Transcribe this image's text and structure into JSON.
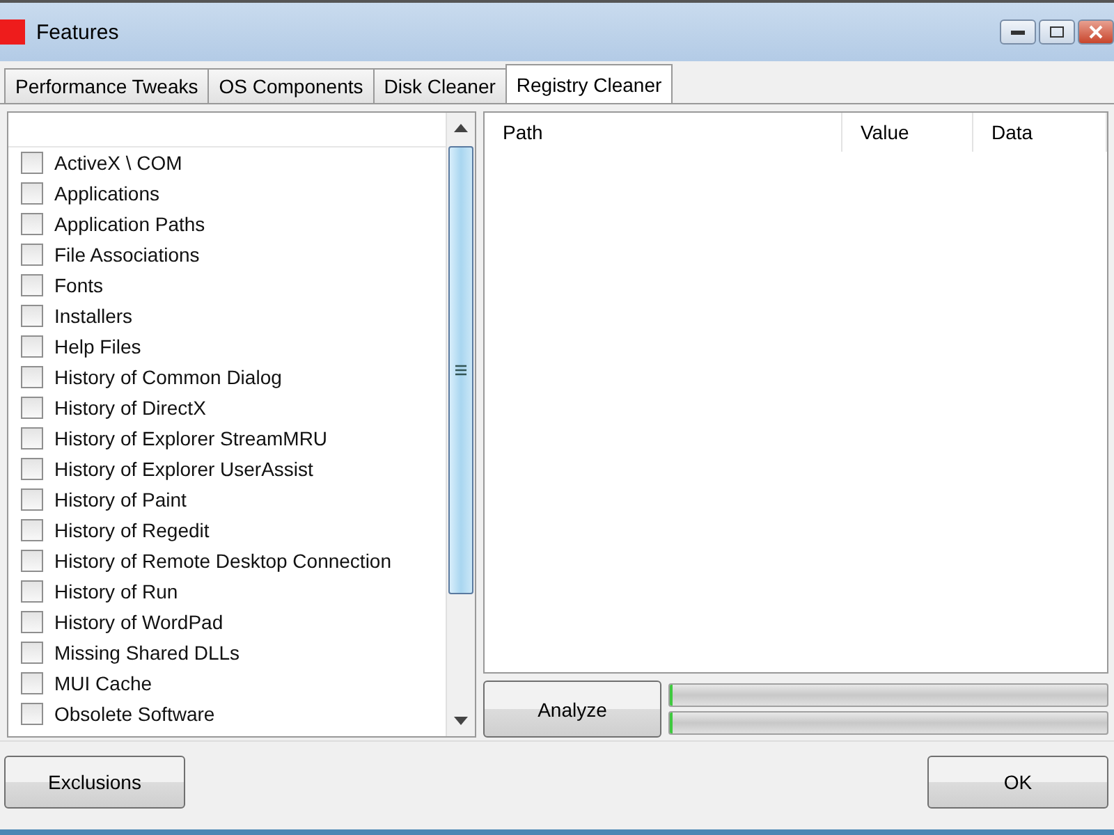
{
  "window": {
    "title": "Features"
  },
  "tabs": [
    {
      "label": "Performance Tweaks",
      "selected": false
    },
    {
      "label": "OS Components",
      "selected": false
    },
    {
      "label": "Disk Cleaner",
      "selected": false
    },
    {
      "label": "Registry Cleaner",
      "selected": true
    }
  ],
  "items": [
    {
      "label": "ActiveX \\ COM",
      "checked": false
    },
    {
      "label": "Applications",
      "checked": false
    },
    {
      "label": "Application Paths",
      "checked": false
    },
    {
      "label": "File Associations",
      "checked": false
    },
    {
      "label": "Fonts",
      "checked": false
    },
    {
      "label": "Installers",
      "checked": false
    },
    {
      "label": "Help Files",
      "checked": false
    },
    {
      "label": "History of Common Dialog",
      "checked": false
    },
    {
      "label": "History of DirectX",
      "checked": false
    },
    {
      "label": "History of Explorer StreamMRU",
      "checked": false
    },
    {
      "label": "History of Explorer UserAssist",
      "checked": false
    },
    {
      "label": "History of Paint",
      "checked": false
    },
    {
      "label": "History of Regedit",
      "checked": false
    },
    {
      "label": "History of Remote Desktop Connection",
      "checked": false
    },
    {
      "label": "History of Run",
      "checked": false
    },
    {
      "label": "History of WordPad",
      "checked": false
    },
    {
      "label": "Missing Shared DLLs",
      "checked": false
    },
    {
      "label": "MUI Cache",
      "checked": false
    },
    {
      "label": "Obsolete Software",
      "checked": false
    }
  ],
  "results_table": {
    "columns": [
      "Path",
      "Value",
      "Data"
    ]
  },
  "analyze_button": "Analyze",
  "progress_bars": [
    {
      "level": 0
    },
    {
      "level": 0
    }
  ],
  "buttons": {
    "exclusions": "Exclusions",
    "ok": "OK"
  }
}
